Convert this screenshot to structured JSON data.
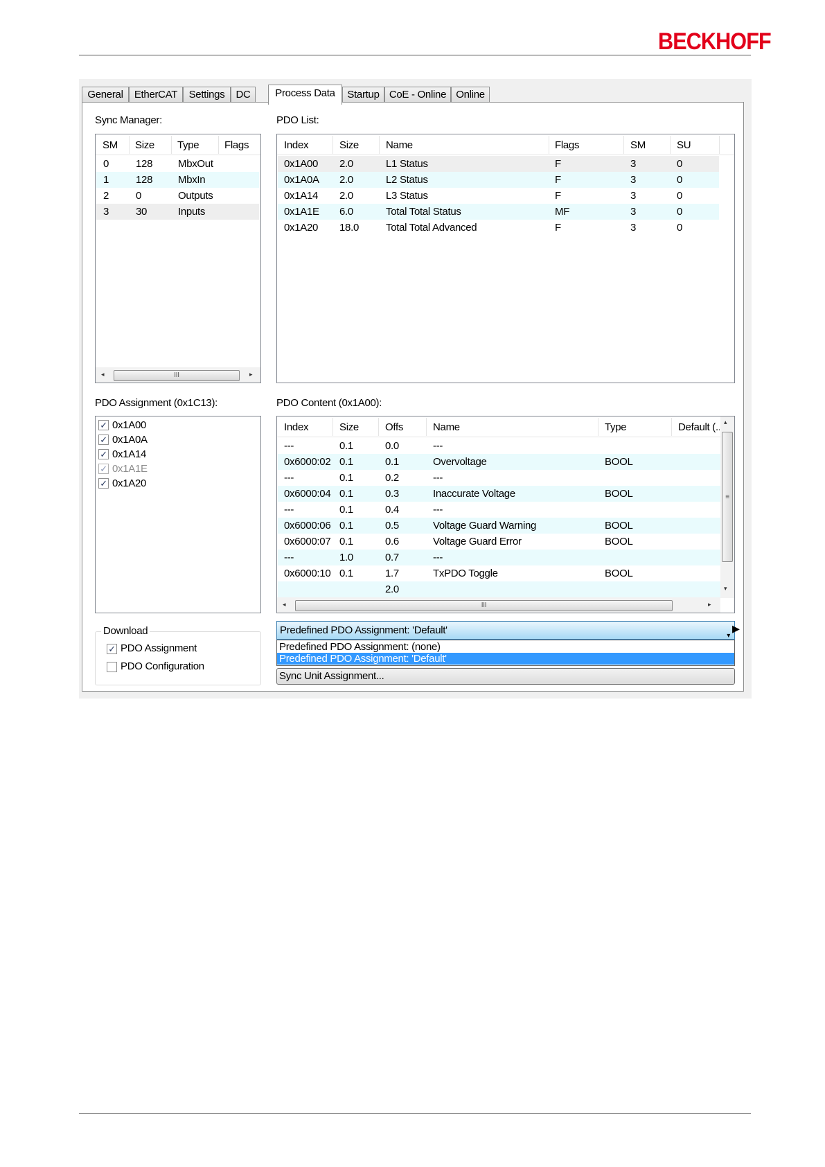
{
  "header": {
    "logo_text": "BECKHOFF",
    "logo_color": "#e2001a"
  },
  "tabs": [
    {
      "label": "General"
    },
    {
      "label": "EtherCAT"
    },
    {
      "label": "Settings"
    },
    {
      "label": "DC"
    },
    {
      "label": "Process Data",
      "active": true
    },
    {
      "label": "Startup"
    },
    {
      "label": "CoE - Online"
    },
    {
      "label": "Online"
    }
  ],
  "sync_manager": {
    "label": "Sync Manager:",
    "columns": [
      "SM",
      "Size",
      "Type",
      "Flags"
    ],
    "rows": [
      [
        "0",
        "128",
        "MbxOut",
        ""
      ],
      [
        "1",
        "128",
        "MbxIn",
        ""
      ],
      [
        "2",
        "0",
        "Outputs",
        ""
      ],
      [
        "3",
        "30",
        "Inputs",
        ""
      ]
    ],
    "scroll_grip": "III"
  },
  "pdo_list": {
    "label": "PDO List:",
    "columns": [
      "Index",
      "Size",
      "Name",
      "Flags",
      "SM",
      "SU"
    ],
    "rows": [
      [
        "0x1A00",
        "2.0",
        "L1 Status",
        "F",
        "3",
        "0"
      ],
      [
        "0x1A0A",
        "2.0",
        "L2 Status",
        "F",
        "3",
        "0"
      ],
      [
        "0x1A14",
        "2.0",
        "L3 Status",
        "F",
        "3",
        "0"
      ],
      [
        "0x1A1E",
        "6.0",
        "Total Total Status",
        "MF",
        "3",
        "0"
      ],
      [
        "0x1A20",
        "18.0",
        "Total Total Advanced",
        "F",
        "3",
        "0"
      ]
    ]
  },
  "pdo_assignment": {
    "label": "PDO Assignment (0x1C13):",
    "items": [
      {
        "label": "0x1A00",
        "checked": true,
        "enabled": true
      },
      {
        "label": "0x1A0A",
        "checked": true,
        "enabled": true
      },
      {
        "label": "0x1A14",
        "checked": true,
        "enabled": true
      },
      {
        "label": "0x1A1E",
        "checked": true,
        "enabled": false
      },
      {
        "label": "0x1A20",
        "checked": true,
        "enabled": true
      }
    ]
  },
  "pdo_content": {
    "label": "PDO Content (0x1A00):",
    "columns": [
      "Index",
      "Size",
      "Offs",
      "Name",
      "Type",
      "Default (..."
    ],
    "rows": [
      [
        "---",
        "0.1",
        "0.0",
        "---",
        ""
      ],
      [
        "0x6000:02",
        "0.1",
        "0.1",
        "Overvoltage",
        "BOOL"
      ],
      [
        "---",
        "0.1",
        "0.2",
        "---",
        ""
      ],
      [
        "0x6000:04",
        "0.1",
        "0.3",
        "Inaccurate Voltage",
        "BOOL"
      ],
      [
        "---",
        "0.1",
        "0.4",
        "---",
        ""
      ],
      [
        "0x6000:06",
        "0.1",
        "0.5",
        "Voltage Guard Warning",
        "BOOL"
      ],
      [
        "0x6000:07",
        "0.1",
        "0.6",
        "Voltage Guard Error",
        "BOOL"
      ],
      [
        "---",
        "1.0",
        "0.7",
        "---",
        ""
      ],
      [
        "0x6000:10",
        "0.1",
        "1.7",
        "TxPDO Toggle",
        "BOOL"
      ],
      [
        "",
        "",
        "2.0",
        "",
        ""
      ]
    ],
    "scroll_grip_h": "III",
    "scroll_grip_v": "≡"
  },
  "download": {
    "label": "Download",
    "pdo_assignment": {
      "label": "PDO Assignment",
      "checked": true
    },
    "pdo_configuration": {
      "label": "PDO Configuration",
      "checked": false
    }
  },
  "predefined": {
    "selected": "Predefined PDO Assignment: 'Default'",
    "options": [
      "Predefined PDO Assignment: (none)",
      "Predefined PDO Assignment: 'Default'"
    ],
    "highlighted_option": "Predefined PDO Assignment: 'Default'",
    "highlight_color": "#3399ff"
  },
  "sync_unit_button": {
    "label": "Sync Unit Assignment..."
  },
  "icons": {
    "check": "✓",
    "left": "◂",
    "right": "▸",
    "up": "▴",
    "down": "▾"
  }
}
